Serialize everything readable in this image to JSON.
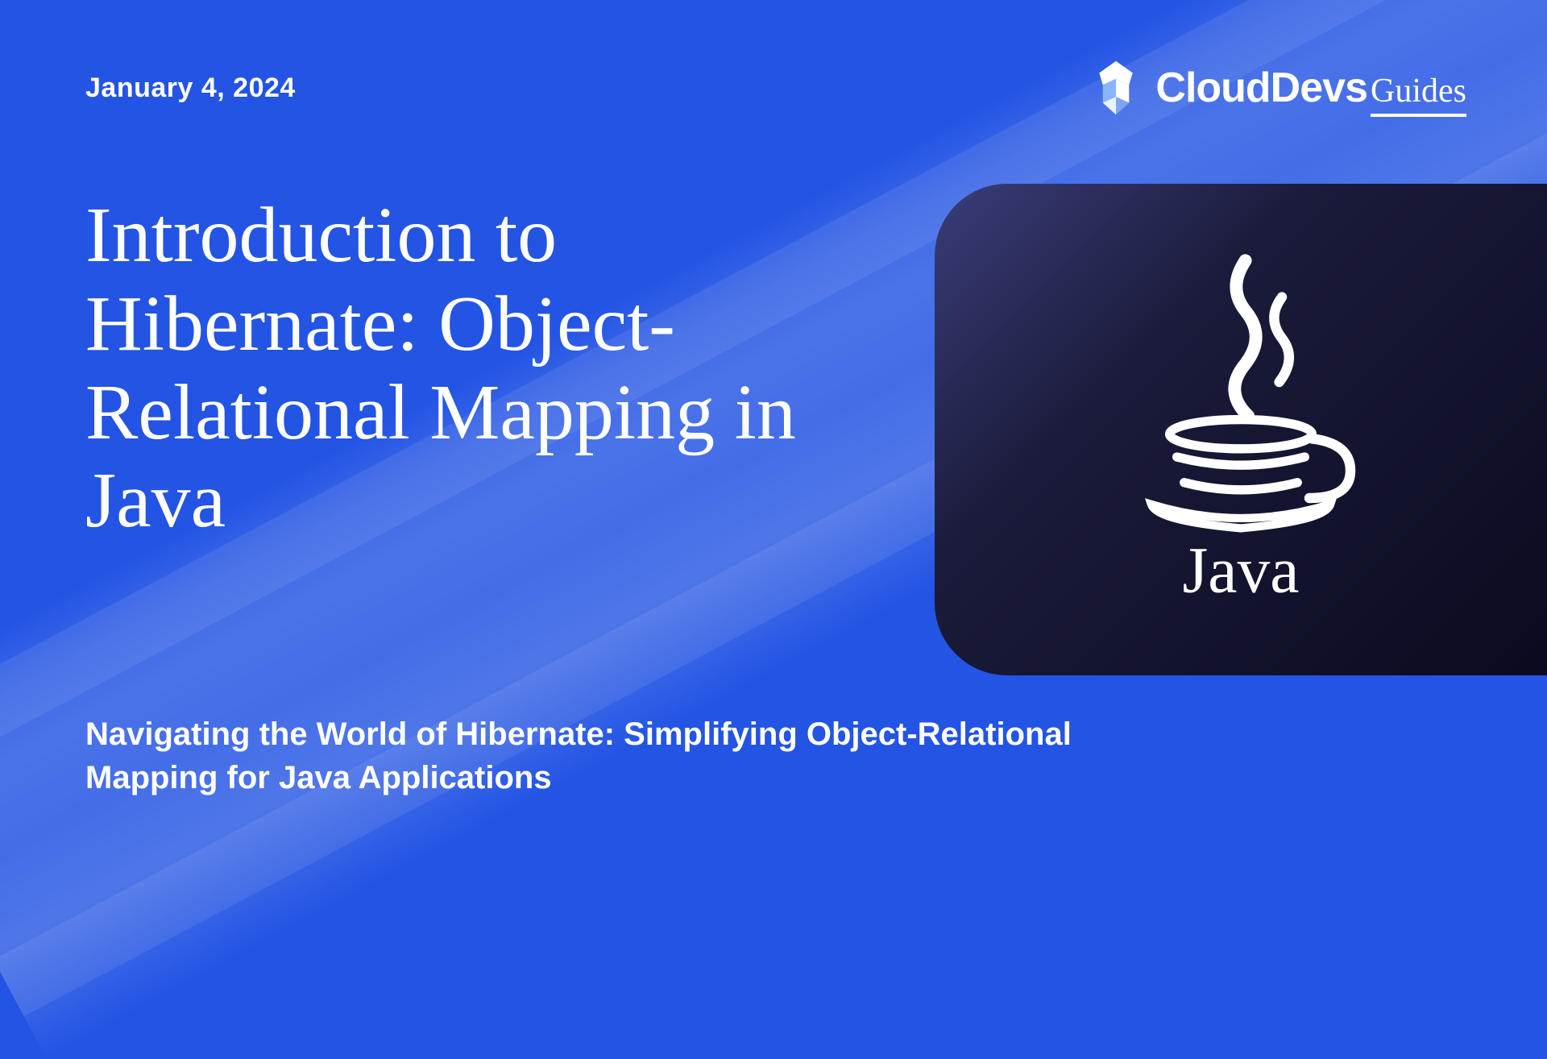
{
  "date": "January 4, 2024",
  "brand": {
    "main": "CloudDevs",
    "sub": "Guides"
  },
  "title": "Introduction to Hibernate: Object-Relational Mapping in Java",
  "subtitle": "Navigating the World of Hibernate: Simplifying Object-Relational Mapping for Java Applications",
  "logo_name": "Java"
}
